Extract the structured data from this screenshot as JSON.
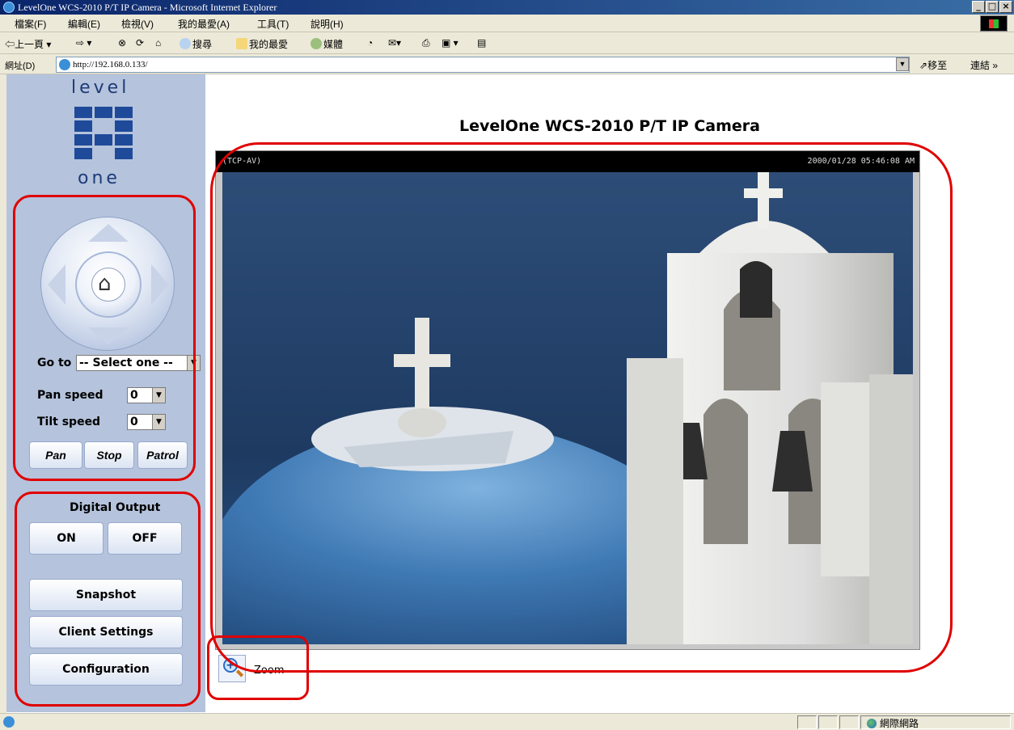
{
  "window": {
    "title": "LevelOne WCS-2010 P/T IP Camera - Microsoft Internet Explorer",
    "minimize": "_",
    "maximize": "□",
    "close": "×"
  },
  "menu": [
    "檔案(F)",
    "編輯(E)",
    "檢視(V)",
    "我的最愛(A)",
    "工具(T)",
    "說明(H)"
  ],
  "toolbar": {
    "back": "上一頁",
    "search": "搜尋",
    "favorites": "我的最愛",
    "media": "媒體"
  },
  "address": {
    "label": "網址(D)",
    "url": "http://192.168.0.133/",
    "go": "移至",
    "links": "連結 »"
  },
  "logo": {
    "top": "level",
    "bottom": "one",
    "brand_color": "#1f4a9a"
  },
  "page": {
    "title": "LevelOne WCS-2010 P/T IP Camera"
  },
  "ptz": {
    "home_icon": "home-icon",
    "goto_label": "Go to",
    "goto_value": "-- Select one --",
    "pan_speed_label": "Pan speed",
    "pan_speed_value": "0",
    "tilt_speed_label": "Tilt speed",
    "tilt_speed_value": "0",
    "pan": "Pan",
    "stop": "Stop",
    "patrol": "Patrol"
  },
  "digital_output": {
    "title": "Digital Output",
    "on": "ON",
    "off": "OFF"
  },
  "actions": {
    "snapshot": "Snapshot",
    "client_settings": "Client Settings",
    "configuration": "Configuration"
  },
  "camera": {
    "osd_left": "(TCP-AV)",
    "osd_right": "2000/01/28 05:46:08 AM",
    "zoom_label": "Zoom"
  },
  "status": {
    "zone": "網際網路"
  },
  "colors": {
    "highlight": "#e00000",
    "sidebar": "#b5c3dc"
  }
}
